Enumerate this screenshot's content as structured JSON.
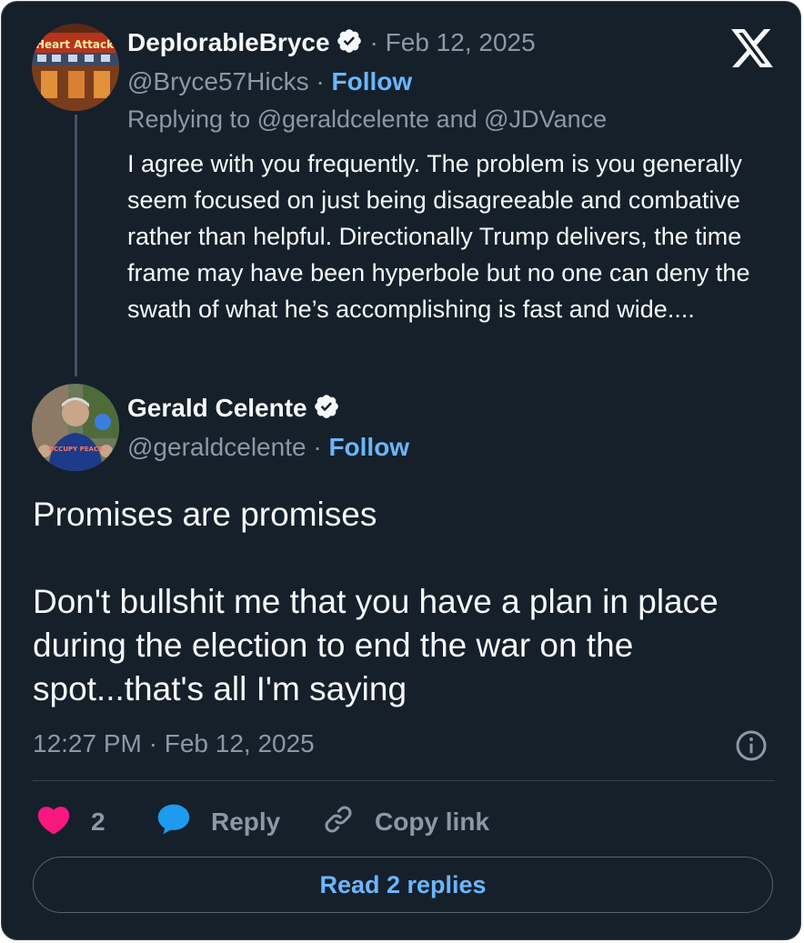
{
  "reply_tweet": {
    "author_name": "DeplorableBryce",
    "date": "· Feb 12, 2025",
    "handle": "@Bryce57Hicks",
    "separator": " · ",
    "follow_label": "Follow",
    "replying_to": "Replying to @geraldcelente and @JDVance",
    "text": "I agree with you frequently. The problem is you generally seem focused on just being disagreeable and combative rather than helpful.  Directionally Trump delivers, the time frame may have been hyperbole but no one can deny the swath of what he’s accomplishing is fast and wide....",
    "avatar_sign_text": "Heart Attack"
  },
  "main_tweet": {
    "author_name": "Gerald Celente",
    "handle": "@geraldcelente",
    "separator": " · ",
    "follow_label": "Follow",
    "text_line1": "Promises are promises",
    "text_line2": "Don't bullshit me that you have a plan in place during the election to end the war on the spot...that's all I'm saying",
    "timestamp": "12:27 PM · Feb 12, 2025",
    "avatar_shirt_text": "OCCUPY PEACE"
  },
  "actions": {
    "like_count": "2",
    "reply_label": "Reply",
    "copy_link_label": "Copy link",
    "read_replies_label": "Read 2 replies"
  },
  "icons": [
    "x-logo-icon",
    "verified-badge-icon",
    "info-icon",
    "heart-icon",
    "reply-bubble-icon",
    "link-icon"
  ],
  "colors": {
    "background": "#15202b",
    "accent": "#6cb6ff",
    "like": "#f91880",
    "reply_icon": "#1d9bf0",
    "muted": "#8b98a5"
  }
}
